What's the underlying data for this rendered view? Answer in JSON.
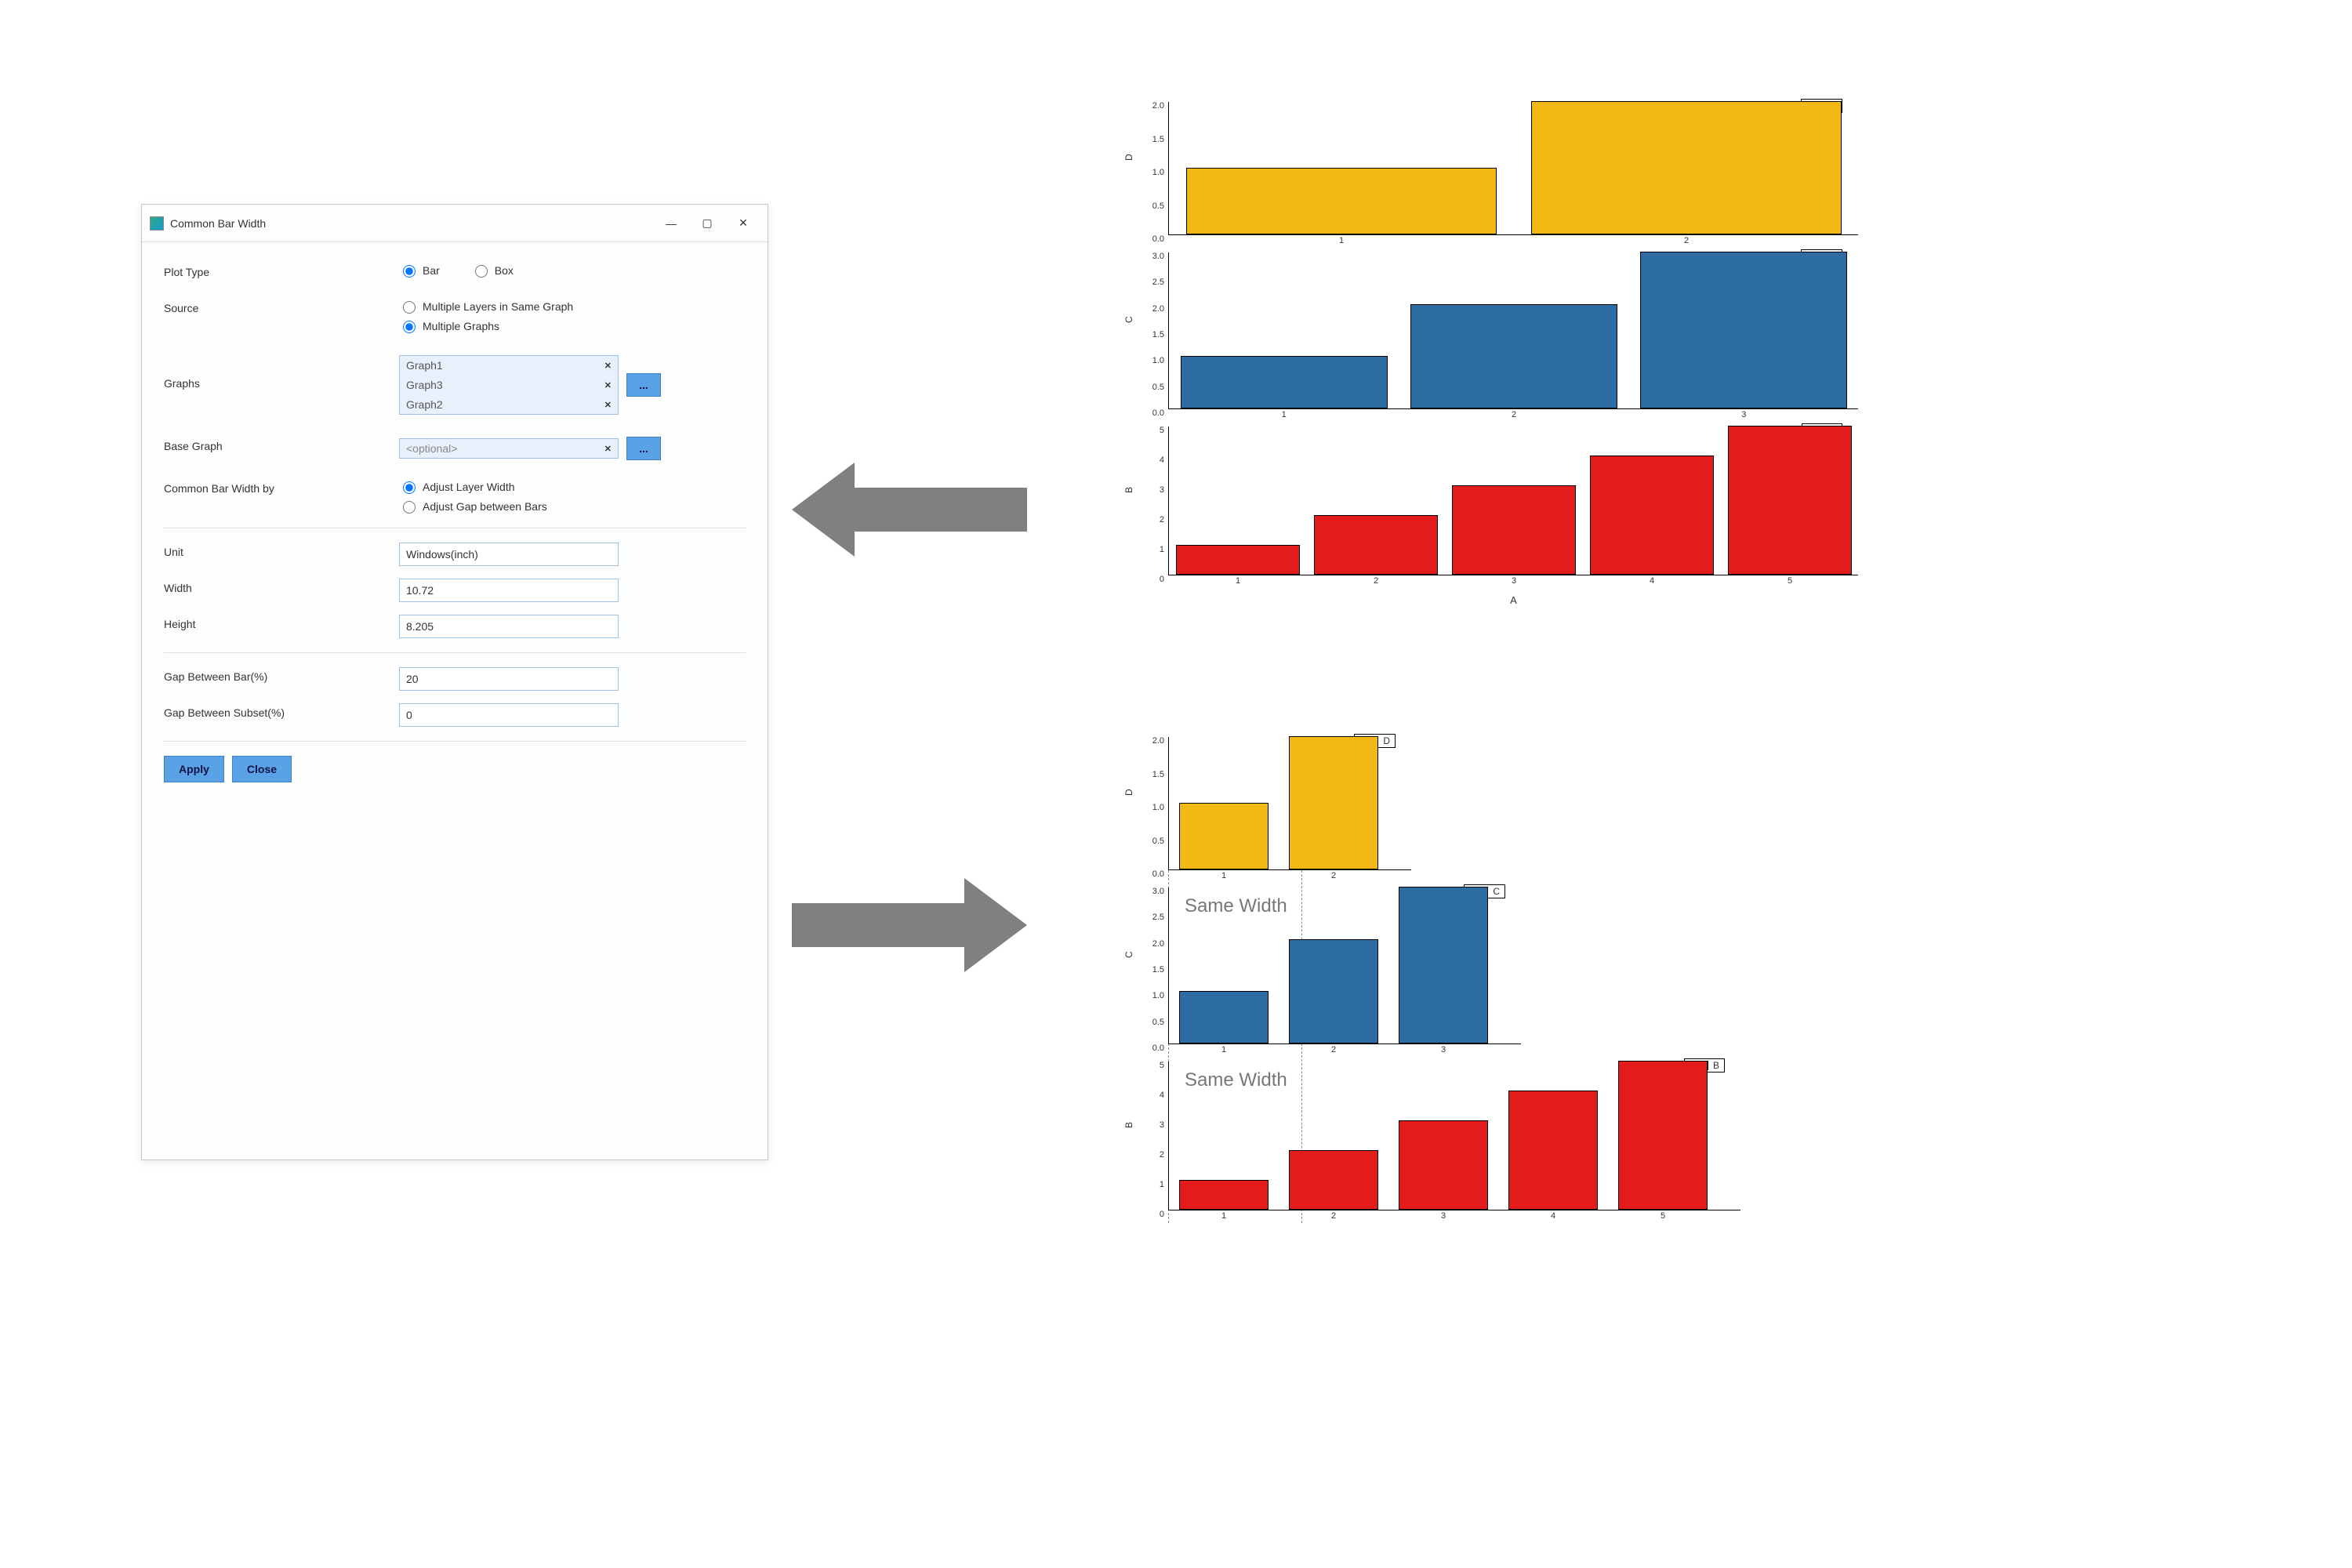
{
  "dialog": {
    "title": "Common Bar Width",
    "labels": {
      "plot_type": "Plot Type",
      "source": "Source",
      "graphs": "Graphs",
      "base_graph": "Base Graph",
      "common_by": "Common Bar Width by",
      "unit": "Unit",
      "width": "Width",
      "height": "Height",
      "gap_bar": "Gap Between Bar(%)",
      "gap_subset": "Gap Between Subset(%)"
    },
    "plot_type": {
      "bar": "Bar",
      "box": "Box",
      "selected": "bar"
    },
    "source": {
      "same_graph": "Multiple Layers in Same Graph",
      "multi_graphs": "Multiple Graphs",
      "selected": "multi_graphs"
    },
    "graphs": [
      "Graph1",
      "Graph3",
      "Graph2"
    ],
    "base_graph_placeholder": "<optional>",
    "common_by": {
      "layer": "Adjust Layer Width",
      "gap": "Adjust Gap between Bars",
      "selected": "layer"
    },
    "unit_value": "Windows(inch)",
    "width_value": "10.72",
    "height_value": "8.205",
    "gap_bar_value": "20",
    "gap_subset_value": "0",
    "buttons": {
      "apply": "Apply",
      "close": "Close",
      "browse": "..."
    }
  },
  "chart_data": [
    {
      "type": "bar",
      "series_name": "D",
      "color": "#f2b914",
      "categories": [
        "1",
        "2"
      ],
      "values": [
        1.0,
        2.0
      ],
      "ylabel": "D",
      "ylim": [
        0,
        2.0
      ],
      "yticks": [
        0.0,
        0.5,
        1.0,
        1.5,
        2.0
      ],
      "block": 1
    },
    {
      "type": "bar",
      "series_name": "C",
      "color": "#2d6ca2",
      "categories": [
        "1",
        "2",
        "3"
      ],
      "values": [
        1.0,
        2.0,
        3.0
      ],
      "ylabel": "C",
      "ylim": [
        0,
        3.0
      ],
      "yticks": [
        0.0,
        0.5,
        1.0,
        1.5,
        2.0,
        2.5,
        3.0
      ],
      "block": 1
    },
    {
      "type": "bar",
      "series_name": "B",
      "color": "#e31b1b",
      "categories": [
        "1",
        "2",
        "3",
        "4",
        "5"
      ],
      "values": [
        1,
        2,
        3,
        4,
        5
      ],
      "ylabel": "B",
      "xlabel": "A",
      "ylim": [
        0,
        5
      ],
      "yticks": [
        0,
        1,
        2,
        3,
        4,
        5
      ],
      "block": 1
    },
    {
      "type": "bar",
      "series_name": "D",
      "color": "#f2b914",
      "categories": [
        "1",
        "2"
      ],
      "values": [
        1.0,
        2.0
      ],
      "ylabel": "D",
      "ylim": [
        0,
        2.0
      ],
      "yticks": [
        0.0,
        0.5,
        1.0,
        1.5,
        2.0
      ],
      "block": 2
    },
    {
      "type": "bar",
      "series_name": "C",
      "color": "#2d6ca2",
      "categories": [
        "1",
        "2",
        "3"
      ],
      "values": [
        1.0,
        2.0,
        3.0
      ],
      "ylabel": "C",
      "ylim": [
        0,
        3.0
      ],
      "yticks": [
        0.0,
        0.5,
        1.0,
        1.5,
        2.0,
        2.5,
        3.0
      ],
      "block": 2,
      "annotation": "Same Width"
    },
    {
      "type": "bar",
      "series_name": "B",
      "color": "#e31b1b",
      "categories": [
        "1",
        "2",
        "3",
        "4",
        "5"
      ],
      "values": [
        1,
        2,
        3,
        4,
        5
      ],
      "ylabel": "B",
      "ylim": [
        0,
        5
      ],
      "yticks": [
        0,
        1,
        2,
        3,
        4,
        5
      ],
      "block": 2,
      "annotation": "Same Width"
    }
  ],
  "annotations": {
    "same_width": "Same Width"
  }
}
